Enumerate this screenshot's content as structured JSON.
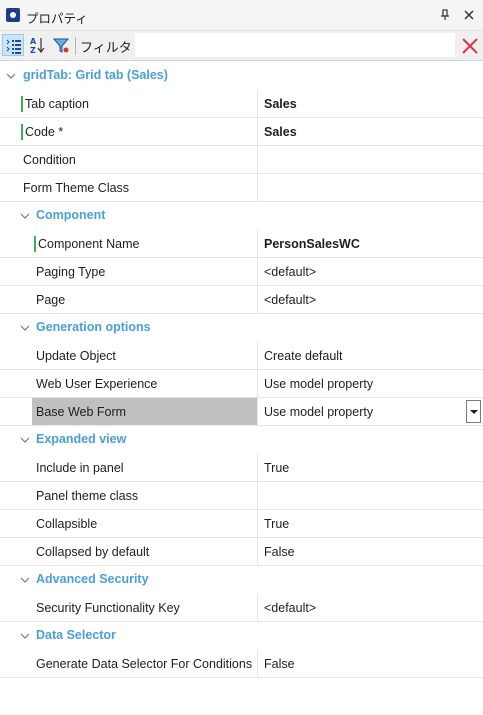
{
  "window": {
    "title": "プロパティ"
  },
  "toolbar": {
    "filter_label": "フィルタ",
    "filter_value": ""
  },
  "grid": {
    "root": {
      "label": "gridTab: Grid tab (Sales)"
    },
    "root_props": [
      {
        "name": "Tab caption",
        "value": "Sales",
        "bold": true,
        "modified": true
      },
      {
        "name": "Code *",
        "value": "Sales",
        "bold": true,
        "modified": true
      },
      {
        "name": "Condition",
        "value": ""
      },
      {
        "name": "Form Theme Class",
        "value": ""
      }
    ],
    "categories": [
      {
        "label": "Component",
        "props": [
          {
            "name": "Component Name",
            "value": "PersonSalesWC",
            "bold": true,
            "modified": true
          },
          {
            "name": "Paging Type",
            "value": "<default>"
          },
          {
            "name": "Page",
            "value": "<default>"
          }
        ]
      },
      {
        "label": "Generation options",
        "props": [
          {
            "name": "Update Object",
            "value": "Create default"
          },
          {
            "name": "Web User Experience",
            "value": "Use model property"
          },
          {
            "name": "Base Web Form",
            "value": "Use model property",
            "selected": true,
            "dropdown": true
          }
        ]
      },
      {
        "label": "Expanded view",
        "props": [
          {
            "name": "Include in panel",
            "value": "True"
          },
          {
            "name": "Panel theme class",
            "value": ""
          },
          {
            "name": "Collapsible",
            "value": "True"
          },
          {
            "name": "Collapsed by default",
            "value": "False"
          }
        ]
      },
      {
        "label": "Advanced Security",
        "props": [
          {
            "name": "Security Functionality Key",
            "value": "<default>"
          }
        ]
      },
      {
        "label": "Data Selector",
        "props": [
          {
            "name": "Generate Data Selector For Conditions",
            "value": "False"
          }
        ]
      }
    ]
  }
}
